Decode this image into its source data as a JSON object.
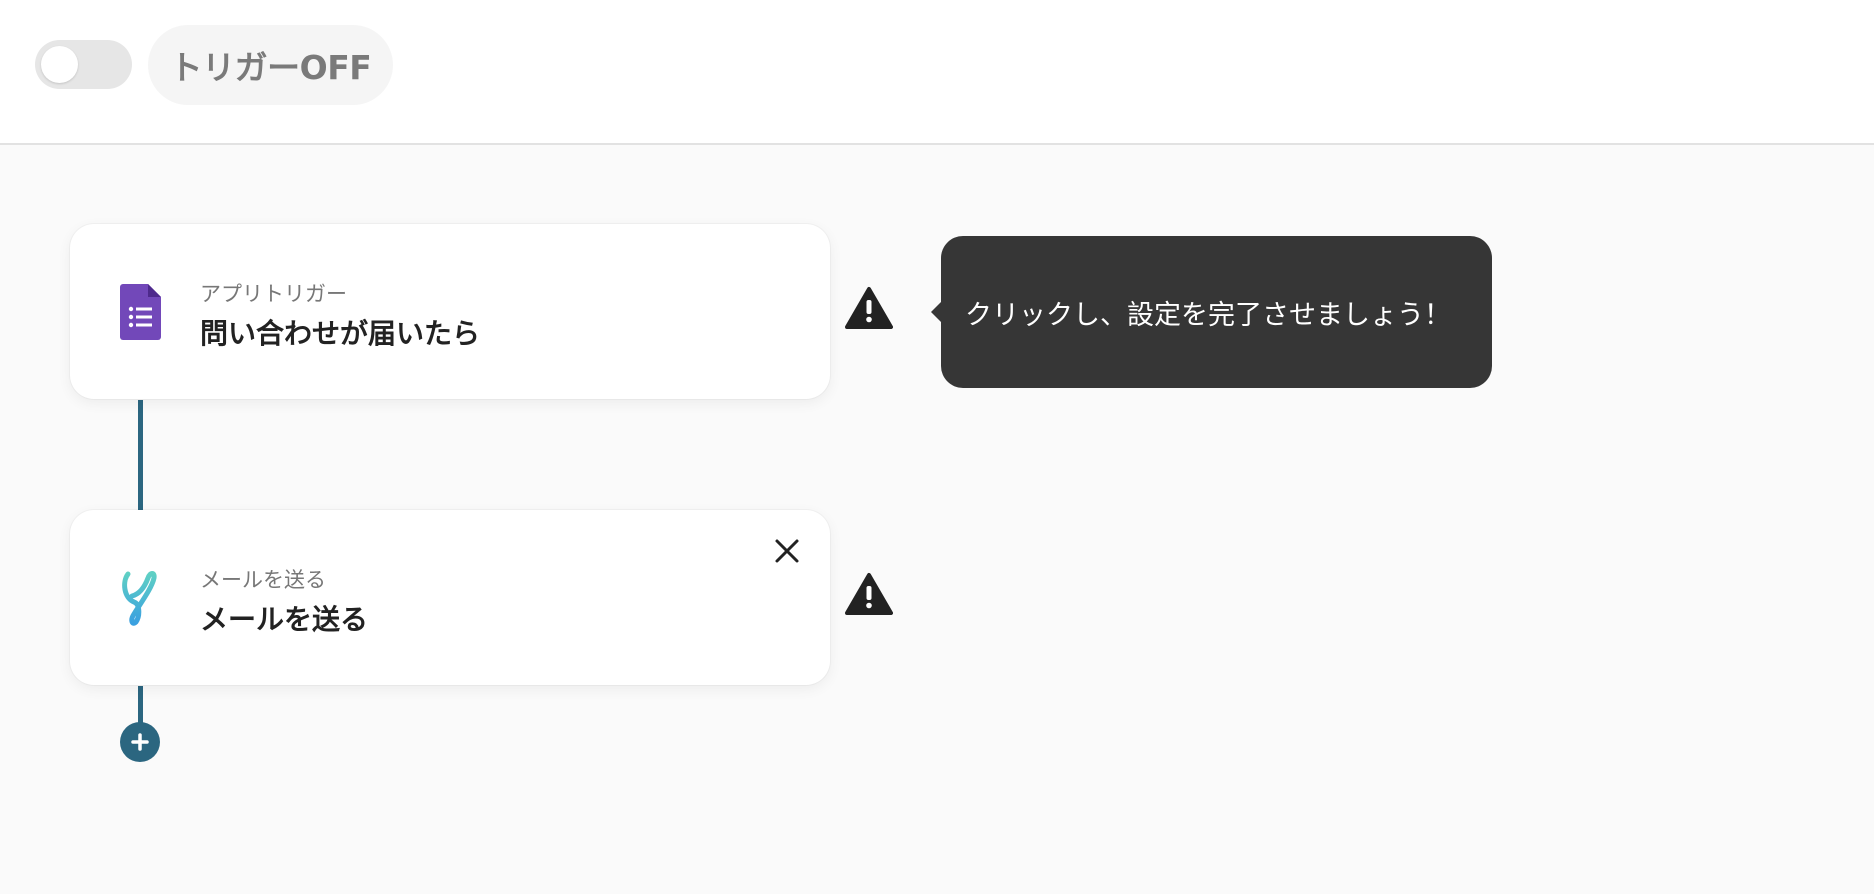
{
  "header": {
    "toggle_state": "off",
    "trigger_status_label": "トリガーOFF"
  },
  "flow": {
    "steps": [
      {
        "subtitle": "アプリトリガー",
        "title": "問い合わせが届いたら",
        "icon": "google-forms-icon",
        "status_icon": "warning-icon"
      },
      {
        "subtitle": "メールを送る",
        "title": "メールを送る",
        "icon": "mail-app-icon",
        "status_icon": "warning-icon",
        "close_icon": "close-icon"
      }
    ],
    "add_step_icon": "plus-icon"
  },
  "tooltip": {
    "text": "クリックし、設定を完了させましょう！"
  },
  "colors": {
    "connector": "#2b6680",
    "tooltip_bg": "#363636",
    "forms_purple": "#7248b9",
    "toggle_bg": "#e6e6e6"
  }
}
